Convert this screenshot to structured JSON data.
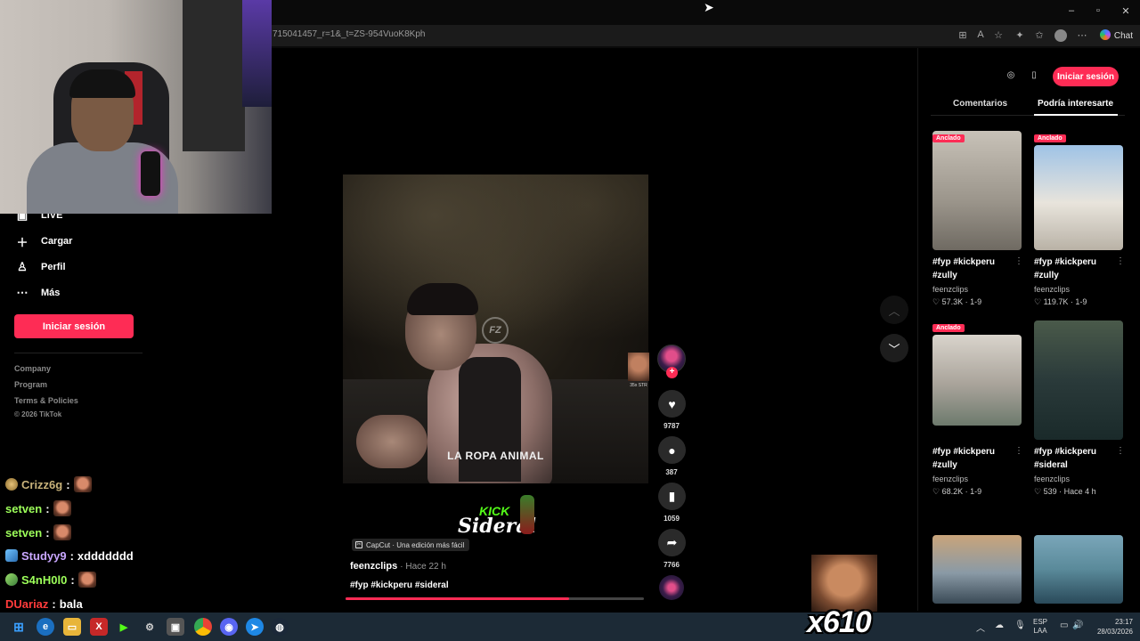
{
  "browser": {
    "url": "715041457_r=1&_t=ZS-954VuoK8Kph",
    "chat_label": "Chat",
    "window_controls": [
      "minimize-icon",
      "maximize-icon",
      "close-icon"
    ]
  },
  "sidebar": {
    "items": [
      {
        "label": "LIVE",
        "icon": "live-icon"
      },
      {
        "label": "Cargar",
        "icon": "plus-icon"
      },
      {
        "label": "Perfil",
        "icon": "person-icon"
      },
      {
        "label": "Más",
        "icon": "more-icon"
      }
    ],
    "login_label": "Iniciar sesión",
    "links": [
      "Company",
      "Program",
      "Terms & Policies"
    ],
    "copyright": "© 2026 TikTok"
  },
  "chat": [
    {
      "user": "Crizz6g",
      "message": "",
      "color": "#c8b27a",
      "emote": true
    },
    {
      "user": "setven",
      "message": "",
      "color": "#9dff5a",
      "emote": true
    },
    {
      "user": "setven",
      "message": "",
      "color": "#9dff5a",
      "emote": true
    },
    {
      "user": "Studyy9",
      "message": "xddddddd",
      "color": "#c9a7ff",
      "emote": false
    },
    {
      "user": "S4nH0l0",
      "message": "",
      "color": "#9dff5a",
      "emote": true
    },
    {
      "user": "DUariaz",
      "message": "bala",
      "color": "#ff3b3b",
      "emote": false
    }
  ],
  "video": {
    "caption": "LA ROPA ANIMAL",
    "watermark_logo": "FZ",
    "capcut_label": "CapCut · Una edición más fácil",
    "author": "feenzclips",
    "time": "· Hace 22 h",
    "description": "#fyp #kickperu #sideral",
    "progress": 0.75,
    "side_thumb_text": "35x STR",
    "kick_logo": {
      "top": "KICK",
      "bottom": "Sideral"
    }
  },
  "actions": {
    "likes": "9787",
    "comments": "387",
    "saves": "1059",
    "shares": "7766"
  },
  "overlay_emote_count": "x610",
  "right_panel": {
    "login_label": "Iniciar sesión",
    "tabs": [
      "Comentarios",
      "Podría interesarte"
    ],
    "pinned_label": "Anclado",
    "recommendations": [
      {
        "title": "#fyp #kickperu #zully",
        "author": "feenzclips",
        "stats": "57.3K · 1-9",
        "pinned": true
      },
      {
        "title": "#fyp #kickperu #zully",
        "author": "feenzclips",
        "stats": "119.7K · 1-9",
        "pinned": true
      },
      {
        "title": "#fyp #kickperu #zully",
        "author": "feenzclips",
        "stats": "68.2K · 1-9",
        "pinned": true
      },
      {
        "title": "#fyp #kickperu #sideral",
        "author": "feenzclips",
        "stats": "539 · Hace 4 h",
        "pinned": false
      }
    ]
  },
  "taskbar": {
    "lang_line1": "ESP",
    "lang_line2": "LAA",
    "time": "23:17",
    "date": "28/03/2026"
  }
}
